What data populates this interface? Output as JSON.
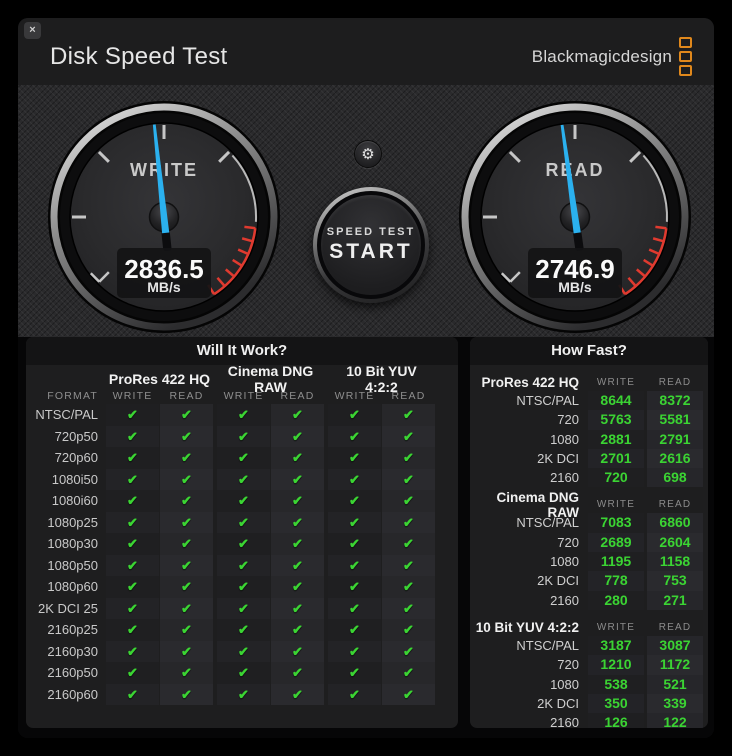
{
  "window": {
    "title": "Disk Speed Test",
    "close_label": "×",
    "brand": "Blackmagicdesign"
  },
  "settings_button": {
    "icon": "gear-icon"
  },
  "start_button": {
    "line1": "SPEED TEST",
    "line2": "START"
  },
  "gauges": {
    "write": {
      "label": "WRITE",
      "value": "2836.5",
      "unit": "MB/s",
      "needle_angle_deg": -6
    },
    "read": {
      "label": "READ",
      "value": "2746.9",
      "unit": "MB/s",
      "needle_angle_deg": -8
    }
  },
  "colors": {
    "needle_blue": "#2bb1ef",
    "accent_green": "#3bd433",
    "redline": "#e03a2f",
    "brand_orange": "#e0881c"
  },
  "will_it_work": {
    "title": "Will It Work?",
    "format_header": "FORMAT",
    "groups": [
      "ProRes 422 HQ",
      "Cinema DNG RAW",
      "10 Bit YUV 4:2:2"
    ],
    "sub_headers": [
      "WRITE",
      "READ"
    ],
    "check_icon": "✔",
    "all_checks_pass": true,
    "formats": [
      "NTSC/PAL",
      "720p50",
      "720p60",
      "1080i50",
      "1080i60",
      "1080p25",
      "1080p30",
      "1080p50",
      "1080p60",
      "2K DCI 25",
      "2160p25",
      "2160p30",
      "2160p50",
      "2160p60"
    ]
  },
  "how_fast": {
    "title": "How Fast?",
    "col_headers": [
      "WRITE",
      "READ"
    ],
    "groups": [
      {
        "label": "ProRes 422 HQ",
        "rows": [
          {
            "format": "NTSC/PAL",
            "write": "8644",
            "read": "8372"
          },
          {
            "format": "720",
            "write": "5763",
            "read": "5581"
          },
          {
            "format": "1080",
            "write": "2881",
            "read": "2791"
          },
          {
            "format": "2K DCI",
            "write": "2701",
            "read": "2616"
          },
          {
            "format": "2160",
            "write": "720",
            "read": "698"
          }
        ]
      },
      {
        "label": "Cinema DNG RAW",
        "rows": [
          {
            "format": "NTSC/PAL",
            "write": "7083",
            "read": "6860"
          },
          {
            "format": "720",
            "write": "2689",
            "read": "2604"
          },
          {
            "format": "1080",
            "write": "1195",
            "read": "1158"
          },
          {
            "format": "2K DCI",
            "write": "778",
            "read": "753"
          },
          {
            "format": "2160",
            "write": "280",
            "read": "271"
          }
        ]
      },
      {
        "label": "10 Bit YUV 4:2:2",
        "rows": [
          {
            "format": "NTSC/PAL",
            "write": "3187",
            "read": "3087"
          },
          {
            "format": "720",
            "write": "1210",
            "read": "1172"
          },
          {
            "format": "1080",
            "write": "538",
            "read": "521"
          },
          {
            "format": "2K DCI",
            "write": "350",
            "read": "339"
          },
          {
            "format": "2160",
            "write": "126",
            "read": "122"
          }
        ]
      }
    ]
  }
}
